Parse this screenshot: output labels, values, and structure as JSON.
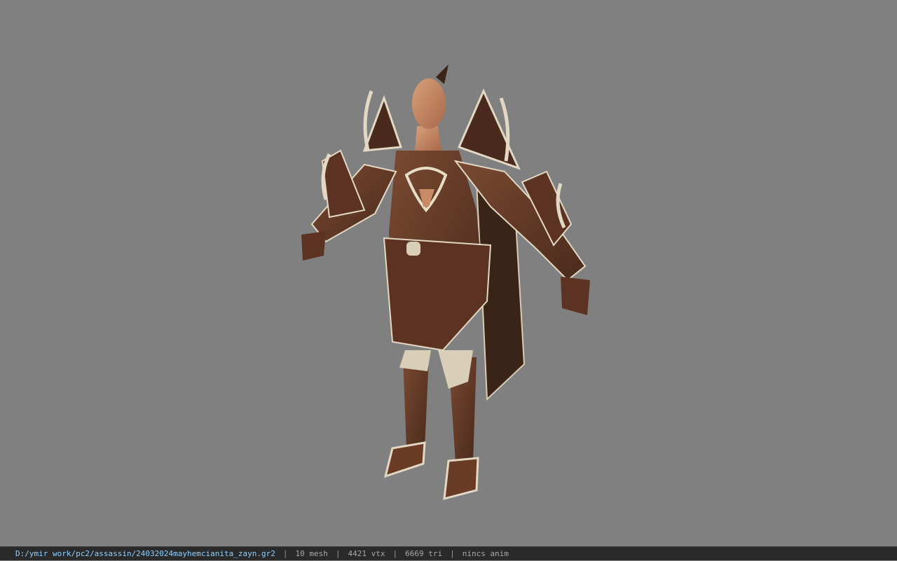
{
  "viewer": {
    "background_color": "#808080",
    "model_icon": "armored-character-model"
  },
  "status": {
    "file_path": "D:/ymir work/pc2/assassin/24032024mayhemcianita_zayn.gr2",
    "separator": "|",
    "mesh": "10 mesh",
    "vtx": "4421 vtx",
    "tri": "6669 tri",
    "anim": "nincs anim"
  }
}
